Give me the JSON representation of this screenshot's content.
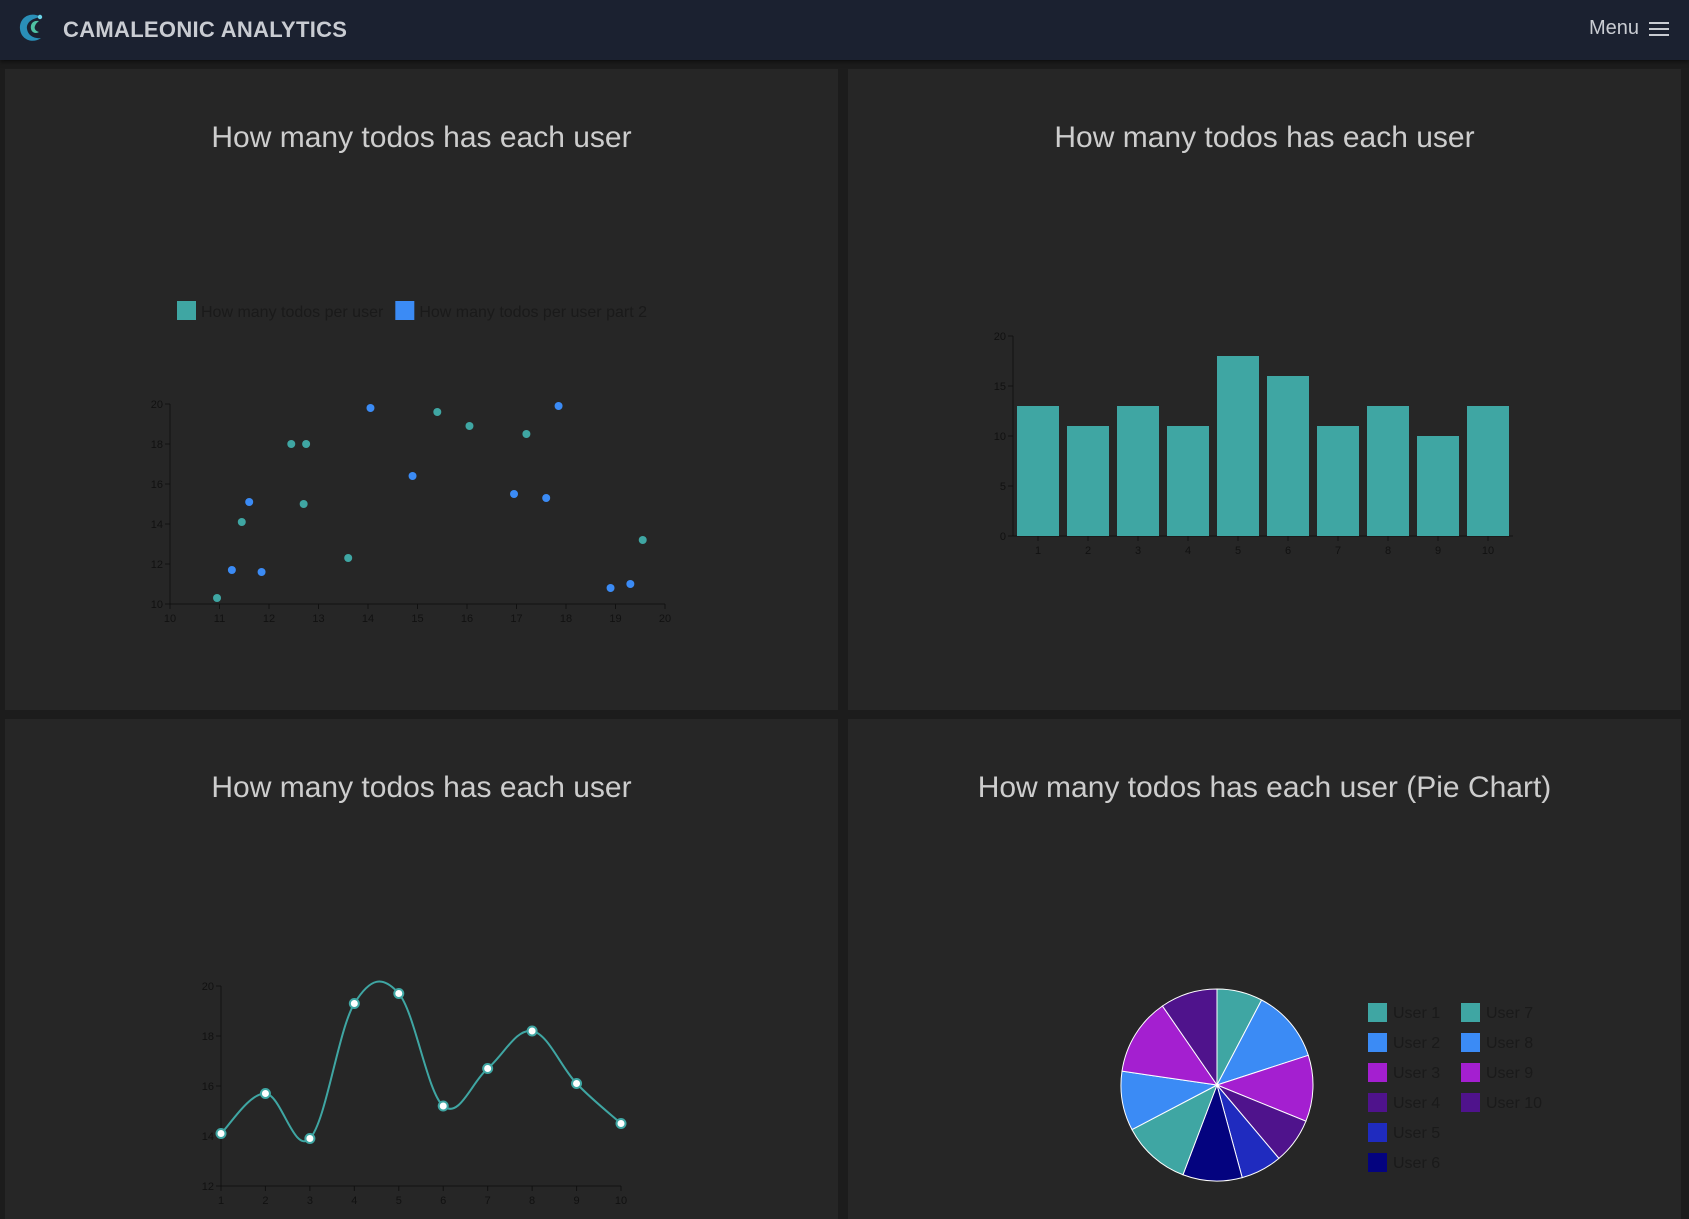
{
  "app": {
    "brand": "CAMALEONIC ANALYTICS",
    "menu_label": "Menu"
  },
  "colors": {
    "teal": "#3fa6a3",
    "blue": "#3b8bf5",
    "purple": "#a41fd0",
    "dark_purple": "#4f138c",
    "royal_blue": "#1f2bbf",
    "navy": "#04037f"
  },
  "panels": {
    "scatter": {
      "title": "How many todos has each user"
    },
    "bar": {
      "title": "How many todos has each user"
    },
    "line": {
      "title": "How many todos has each user"
    },
    "pie": {
      "title": "How many todos has each user (Pie Chart)"
    }
  },
  "chart_data": [
    {
      "type": "scatter",
      "title": "How many todos has each user",
      "xlim": [
        10,
        20
      ],
      "ylim": [
        10,
        20
      ],
      "x_ticks": [
        10,
        11,
        12,
        13,
        14,
        15,
        16,
        17,
        18,
        19,
        20
      ],
      "y_ticks": [
        10,
        12,
        14,
        16,
        18,
        20
      ],
      "legend_position": "top",
      "series": [
        {
          "name": "How many todos per user",
          "color": "#3fa6a3",
          "points": [
            [
              10.95,
              10.3
            ],
            [
              11.45,
              14.1
            ],
            [
              12.45,
              18.0
            ],
            [
              12.75,
              18.0
            ],
            [
              12.7,
              15.0
            ],
            [
              13.6,
              12.3
            ],
            [
              15.4,
              19.6
            ],
            [
              16.05,
              18.9
            ],
            [
              17.2,
              18.5
            ],
            [
              19.55,
              13.2
            ]
          ]
        },
        {
          "name": "How many todos per user part 2",
          "color": "#3b8bf5",
          "points": [
            [
              11.25,
              11.7
            ],
            [
              11.6,
              15.1
            ],
            [
              11.85,
              11.6
            ],
            [
              14.05,
              19.8
            ],
            [
              14.9,
              16.4
            ],
            [
              16.95,
              15.5
            ],
            [
              17.6,
              15.3
            ],
            [
              17.85,
              19.9
            ],
            [
              18.9,
              10.8
            ],
            [
              19.3,
              11.0
            ]
          ]
        }
      ]
    },
    {
      "type": "bar",
      "title": "How many todos has each user",
      "categories": [
        "1",
        "2",
        "3",
        "4",
        "5",
        "6",
        "7",
        "8",
        "9",
        "10"
      ],
      "values": [
        13,
        11,
        13,
        11,
        18,
        16,
        11,
        13,
        10,
        13
      ],
      "ylim": [
        0,
        20
      ],
      "y_ticks": [
        0,
        5,
        10,
        15,
        20
      ],
      "color": "#3fa6a3"
    },
    {
      "type": "line",
      "title": "How many todos has each user",
      "x": [
        1,
        2,
        3,
        4,
        5,
        6,
        7,
        8,
        9,
        10
      ],
      "values": [
        14.1,
        15.7,
        13.9,
        19.3,
        19.7,
        15.2,
        16.7,
        18.2,
        16.1,
        14.5
      ],
      "ylim": [
        12,
        20
      ],
      "y_ticks": [
        12,
        14,
        16,
        18,
        20
      ],
      "color": "#3fa6a3",
      "smooth": true
    },
    {
      "type": "pie",
      "title": "How many todos has each user (Pie Chart)",
      "legend_position": "right",
      "slices": [
        {
          "label": "User 1",
          "value": 20,
          "color": "#3fa6a3"
        },
        {
          "label": "User 2",
          "value": 32,
          "color": "#3b8bf5"
        },
        {
          "label": "User 3",
          "value": 29,
          "color": "#a41fd0"
        },
        {
          "label": "User 4",
          "value": 20,
          "color": "#4f138c"
        },
        {
          "label": "User 5",
          "value": 18,
          "color": "#1f2bbf"
        },
        {
          "label": "User 6",
          "value": 26,
          "color": "#04037f"
        },
        {
          "label": "User 7",
          "value": 30,
          "color": "#3fa6a3"
        },
        {
          "label": "User 8",
          "value": 26,
          "color": "#3b8bf5"
        },
        {
          "label": "User 9",
          "value": 34,
          "color": "#a41fd0"
        },
        {
          "label": "User 10",
          "value": 25,
          "color": "#4f138c"
        }
      ]
    }
  ]
}
